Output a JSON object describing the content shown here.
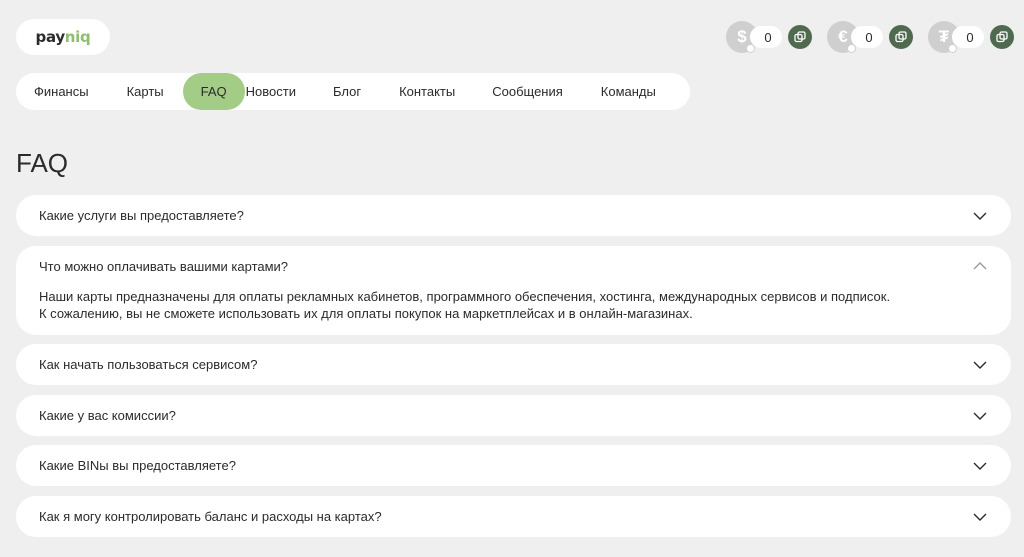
{
  "logo": {
    "text_main": "pay",
    "text_accent": "niq"
  },
  "balances": [
    {
      "symbol": "$",
      "icon": "dollar-icon",
      "amount": "0"
    },
    {
      "symbol": "€",
      "icon": "euro-icon",
      "amount": "0"
    },
    {
      "symbol": "₮",
      "icon": "tether-icon",
      "amount": "0"
    }
  ],
  "nav": {
    "items": [
      {
        "label": "Финансы"
      },
      {
        "label": "Карты"
      },
      {
        "label": "FAQ",
        "active": true
      },
      {
        "label": "Новости"
      },
      {
        "label": "Блог"
      },
      {
        "label": "Контакты"
      },
      {
        "label": "Сообщения"
      },
      {
        "label": "Команды"
      }
    ]
  },
  "page": {
    "title": "FAQ"
  },
  "faq": [
    {
      "question": "Какие услуги вы предоставляете?",
      "expanded": false
    },
    {
      "question": "Что можно оплачивать вашими картами?",
      "expanded": true,
      "answer_line1": "Наши карты предназначены для оплаты рекламных кабинетов, программного обеспечения, хостинга, международных сервисов и подписок.",
      "answer_line2": "К сожалению, вы не сможете использовать их для оплаты покупок на маркетплейсах и в онлайн-магазинах."
    },
    {
      "question": "Как начать пользоваться сервисом?",
      "expanded": false
    },
    {
      "question": "Какие у вас комиссии?",
      "expanded": false
    },
    {
      "question": "Какие BINы вы предоставляете?",
      "expanded": false
    },
    {
      "question": "Как я могу контролировать баланс и расходы на картах?",
      "expanded": false
    }
  ],
  "colors": {
    "accent": "#a3cc86",
    "copy_button": "#4f6a4f",
    "background": "#efefef"
  }
}
